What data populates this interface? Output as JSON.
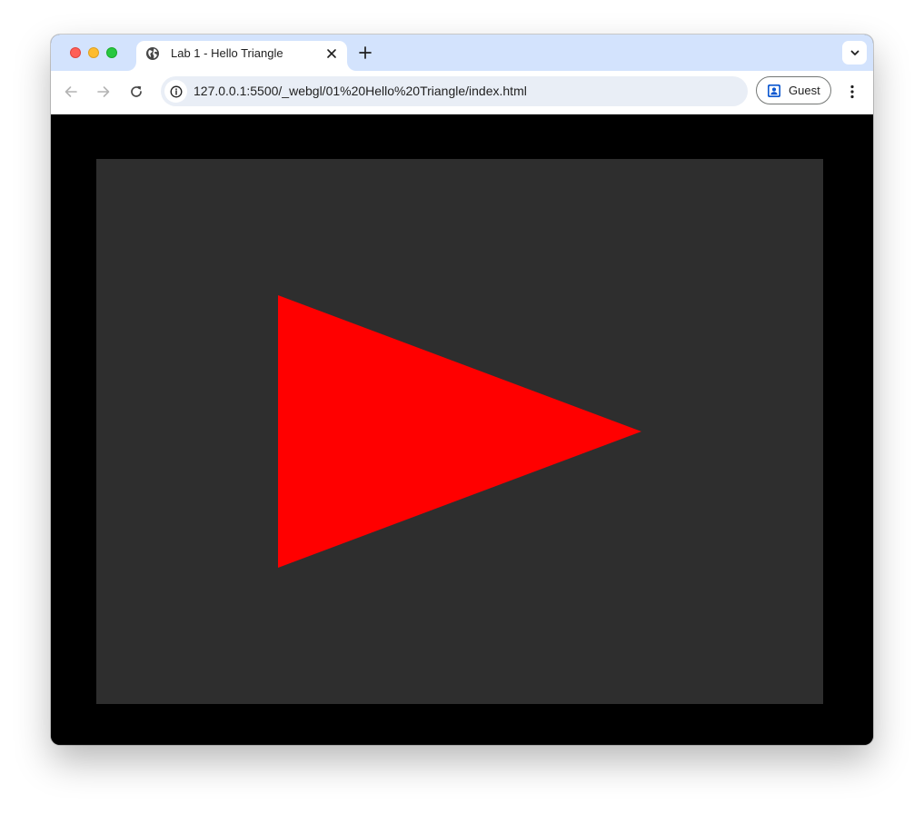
{
  "browser": {
    "window_controls": {
      "close": "close",
      "minimize": "minimize",
      "zoom": "zoom"
    },
    "tab": {
      "title": "Lab 1 - Hello Triangle",
      "favicon": "globe-icon",
      "close_icon": "close-icon"
    },
    "new_tab_icon": "plus-icon",
    "tab_search_icon": "chevron-down-icon",
    "toolbar": {
      "back_icon": "arrow-left-icon",
      "forward_icon": "arrow-right-icon",
      "reload_icon": "reload-icon",
      "site_info_icon": "info-icon",
      "url": "127.0.0.1:5500/_webgl/01%20Hello%20Triangle/index.html",
      "profile_label": "Guest",
      "profile_icon": "person-badge-icon",
      "menu_icon": "kebab-menu-icon"
    },
    "colors": {
      "titlebar": "#d3e3fd",
      "omnibox": "#e9eef6",
      "accent": "#0b57d0"
    }
  },
  "page": {
    "background": "#000000",
    "canvas": {
      "clear_color": "#2e2e2e",
      "triangle_color": "#ff0000",
      "triangle_vertices": [
        [
          -0.5,
          0.5
        ],
        [
          -0.5,
          -0.5
        ],
        [
          0.5,
          0.0
        ]
      ]
    }
  }
}
